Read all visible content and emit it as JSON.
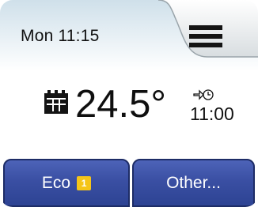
{
  "header": {
    "datetime": "Mon 11:15",
    "menu_icon": "hamburger-menu-icon"
  },
  "main": {
    "calendar_icon": "calendar-icon",
    "temperature": "24.5°",
    "schedule_icon": "clock-schedule-icon",
    "next_change_time": "11:00"
  },
  "buttons": {
    "eco_label": "Eco",
    "eco_badge": "1",
    "other_label": "Other..."
  },
  "colors": {
    "header_tab": "#ccdde8",
    "button_blue": "#3a4fa3",
    "badge_yellow": "#f5c518"
  }
}
